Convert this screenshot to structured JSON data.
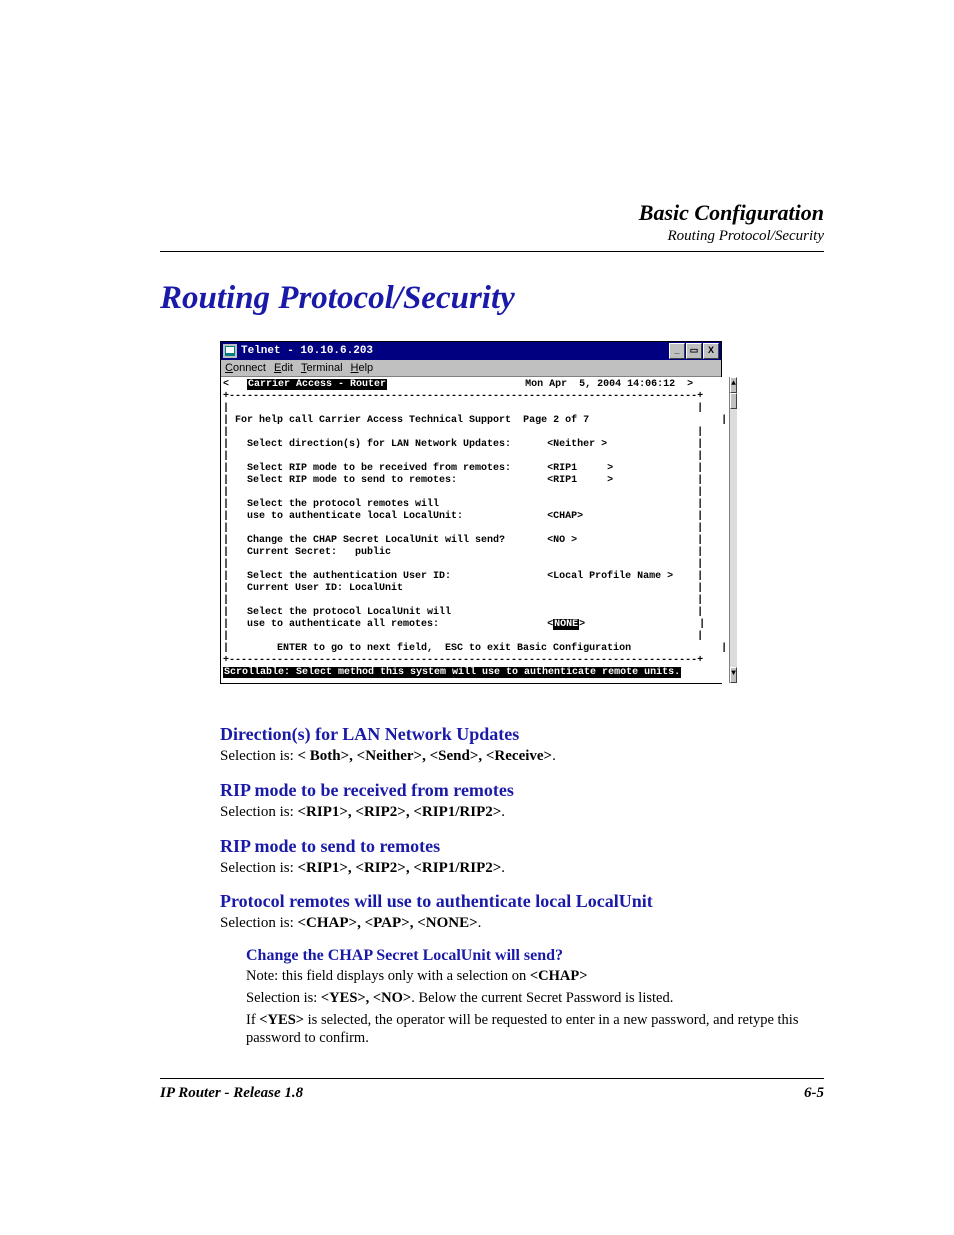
{
  "running_head": {
    "line1": "Basic Configuration",
    "line2": "Routing Protocol/Security"
  },
  "page_title": "Routing Protocol/Security",
  "telnet": {
    "title": "Telnet - 10.10.6.203",
    "menu": {
      "connect": "Connect",
      "edit": "Edit",
      "terminal": "Terminal",
      "help": "Help"
    },
    "winbtns": {
      "min": "_",
      "max": "▭",
      "close": "X"
    },
    "scroll": {
      "up": "▲",
      "down": "▼"
    },
    "header_left": "Carrier Access - Router",
    "header_right": "Mon Apr  5, 2004 14:06:12",
    "help_line": "For help call Carrier Access Technical Support  Page 2 of 7",
    "rows": {
      "r1_label": "Select direction(s) for LAN Network Updates:",
      "r1_val": "<Neither >",
      "r2_label": "Select RIP mode to be received from remotes:",
      "r2_val": "<RIP1     >",
      "r3_label": "Select RIP mode to send to remotes:",
      "r3_val": "<RIP1     >",
      "r4a": "Select the protocol remotes will",
      "r4b": "use to authenticate local LocalUnit:",
      "r4_val": "<CHAP>",
      "r5_label": "Change the CHAP Secret LocalUnit will send?",
      "r5_val": "<NO >",
      "r5_sub": "Current Secret:   public",
      "r6_label": "Select the authentication User ID:",
      "r6_val": "<Local Profile Name >",
      "r6_sub": "Current User ID: LocalUnit",
      "r7a": "Select the protocol LocalUnit will",
      "r7b": "use to authenticate all remotes:",
      "r7_val": "<",
      "r7_val_inv": "NONE",
      "r7_val_end": ">"
    },
    "instr": "ENTER to go to next field,  ESC to exit Basic Configuration",
    "status": "Scrollable: Select method this system will use to authenticate remote units."
  },
  "sections": {
    "s1_h": "Direction(s) for LAN Network Updates",
    "s1_p_pre": "Selection is: ",
    "s1_p_opts": "< Both>, <Neither>, <Send>, <Receive>",
    "s2_h": "RIP mode to be received from remotes",
    "s2_p_pre": "Selection is: ",
    "s2_p_opts": "<RIP1>, <RIP2>, <RIP1/RIP2>",
    "s3_h": "RIP mode to send to remotes",
    "s3_p_pre": "Selection is: ",
    "s3_p_opts": "<RIP1>, <RIP2>, <RIP1/RIP2>",
    "s4_h": "Protocol remotes will use to authenticate local LocalUnit",
    "s4_p_pre": "Selection is: ",
    "s4_p_opts": "<CHAP>, <PAP>, <NONE>",
    "s5_h": "Change the CHAP Secret LocalUnit will send?",
    "s5_p1a": "Note: this field displays only with a selection on ",
    "s5_p1b": "<CHAP>",
    "s5_p2a": "Selection is: ",
    "s5_p2b": "<YES>, <NO>",
    "s5_p2c": ". Below the current Secret Password is listed.",
    "s5_p3a": "If ",
    "s5_p3b": "<YES>",
    "s5_p3c": " is selected, the operator will be requested to enter in a new password, and retype this password to confirm."
  },
  "footer": {
    "left": "IP Router - Release 1.8",
    "right": "6-5"
  }
}
